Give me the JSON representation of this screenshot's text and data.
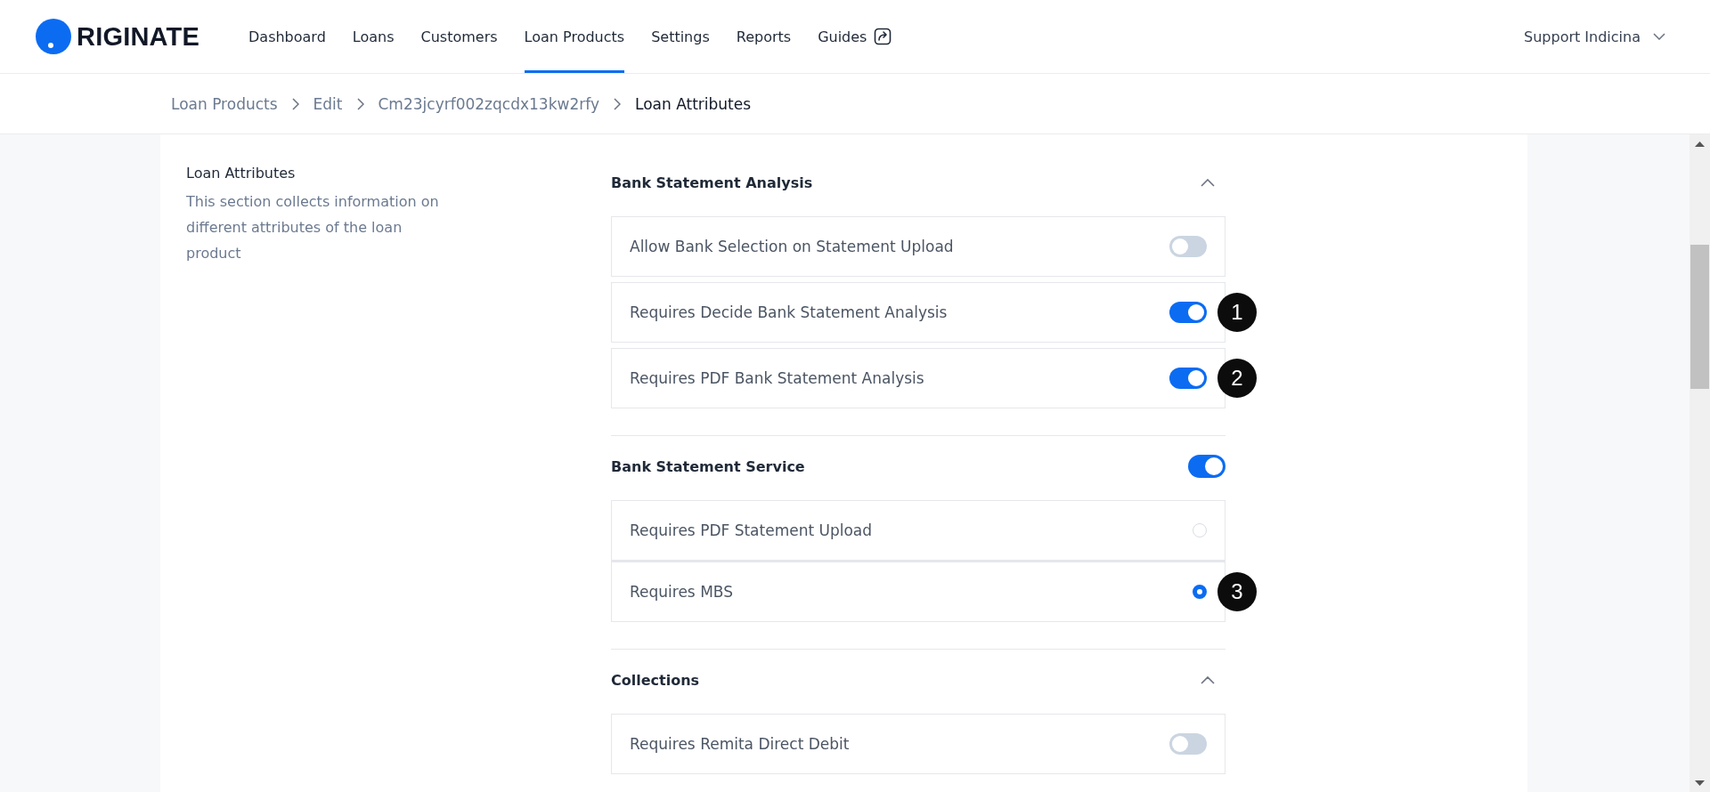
{
  "brand": {
    "name": "RIGINATE"
  },
  "nav": [
    {
      "label": "Dashboard",
      "selected": false,
      "external": false
    },
    {
      "label": "Loans",
      "selected": false,
      "external": false
    },
    {
      "label": "Customers",
      "selected": false,
      "external": false
    },
    {
      "label": "Loan Products",
      "selected": true,
      "external": false
    },
    {
      "label": "Settings",
      "selected": false,
      "external": false
    },
    {
      "label": "Reports",
      "selected": false,
      "external": false
    },
    {
      "label": "Guides",
      "selected": false,
      "external": true
    }
  ],
  "user": {
    "name": "Support Indicina"
  },
  "breadcrumb": [
    {
      "label": "Loan Products",
      "current": false
    },
    {
      "label": "Edit",
      "current": false
    },
    {
      "label": "Cm23jcyrf002zqcdx13kw2rfy",
      "current": false
    },
    {
      "label": "Loan Attributes",
      "current": true
    }
  ],
  "intro": {
    "title": "Loan Attributes",
    "description": "This section collects information on different attributes of the loan product"
  },
  "sections": [
    {
      "title": "Bank Statement Analysis",
      "kind": "collapse",
      "expanded": true,
      "items": [
        {
          "kind": "toggle",
          "label": "Allow Bank Selection on Statement Upload",
          "on": false
        },
        {
          "kind": "toggle",
          "label": "Requires Decide Bank Statement Analysis",
          "on": true,
          "marker": "1"
        },
        {
          "kind": "toggle",
          "label": "Requires PDF Bank Statement Analysis",
          "on": true,
          "marker": "2"
        }
      ]
    },
    {
      "title": "Bank Statement Service",
      "kind": "toggle",
      "on": true,
      "items": [
        {
          "kind": "radio",
          "label": "Requires PDF Statement Upload",
          "selected": false
        },
        {
          "kind": "radio",
          "label": "Requires MBS",
          "selected": true,
          "marker": "3"
        }
      ]
    },
    {
      "title": "Collections",
      "kind": "collapse",
      "expanded": true,
      "items": [
        {
          "kind": "toggle",
          "label": "Requires Remita Direct Debit",
          "on": false
        }
      ]
    }
  ]
}
